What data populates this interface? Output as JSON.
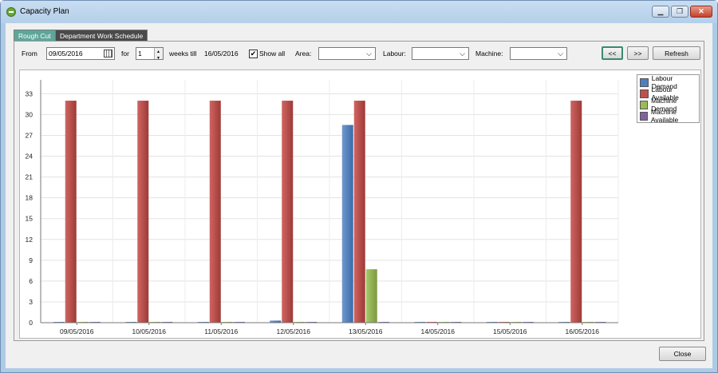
{
  "window": {
    "title": "Capacity Plan",
    "minimize_glyph": "▁",
    "restore_glyph": "❐",
    "close_glyph": "✕"
  },
  "tabs": [
    {
      "label": "Rough Cut",
      "active": true
    },
    {
      "label": "Department Work Schedule",
      "active": false
    }
  ],
  "filters": {
    "from_label": "From",
    "from_value": "09/05/2016",
    "for_label": "for",
    "for_value": "1",
    "weeks_till_label": "weeks till",
    "till_value": "16/05/2016",
    "show_all_label": "Show all",
    "show_all_checked": "✔",
    "area_label": "Area:",
    "area_value": "",
    "labour_label": "Labour:",
    "labour_value": "",
    "machine_label": "Machine:",
    "machine_value": ""
  },
  "nav": {
    "prev_label": "<<",
    "next_label": ">>",
    "refresh_label": "Refresh"
  },
  "footer": {
    "close_label": "Close"
  },
  "chart_data": {
    "type": "bar",
    "categories": [
      "09/05/2016",
      "10/05/2016",
      "11/05/2016",
      "12/05/2016",
      "13/05/2016",
      "14/05/2016",
      "15/05/2016",
      "16/05/2016"
    ],
    "series": [
      {
        "name": "Labour Demand",
        "color": "#4f7fbf",
        "values": [
          0,
          0,
          0,
          0.3,
          28.5,
          0,
          0,
          0
        ]
      },
      {
        "name": "Labour Available",
        "color": "#c0504d",
        "values": [
          32,
          32,
          32,
          32,
          32,
          0,
          0,
          32
        ]
      },
      {
        "name": "Machine Demand",
        "color": "#9bbb59",
        "values": [
          0,
          0,
          0,
          0,
          7.7,
          0,
          0,
          0
        ]
      },
      {
        "name": "Machine Available",
        "color": "#8064a2",
        "values": [
          0,
          0,
          0,
          0,
          0,
          0,
          0,
          0
        ]
      }
    ],
    "yticks": [
      0,
      3,
      6,
      9,
      12,
      15,
      18,
      21,
      24,
      27,
      30,
      33
    ],
    "ylim": [
      0,
      35
    ],
    "grid": true,
    "legend_position": "top-right"
  }
}
